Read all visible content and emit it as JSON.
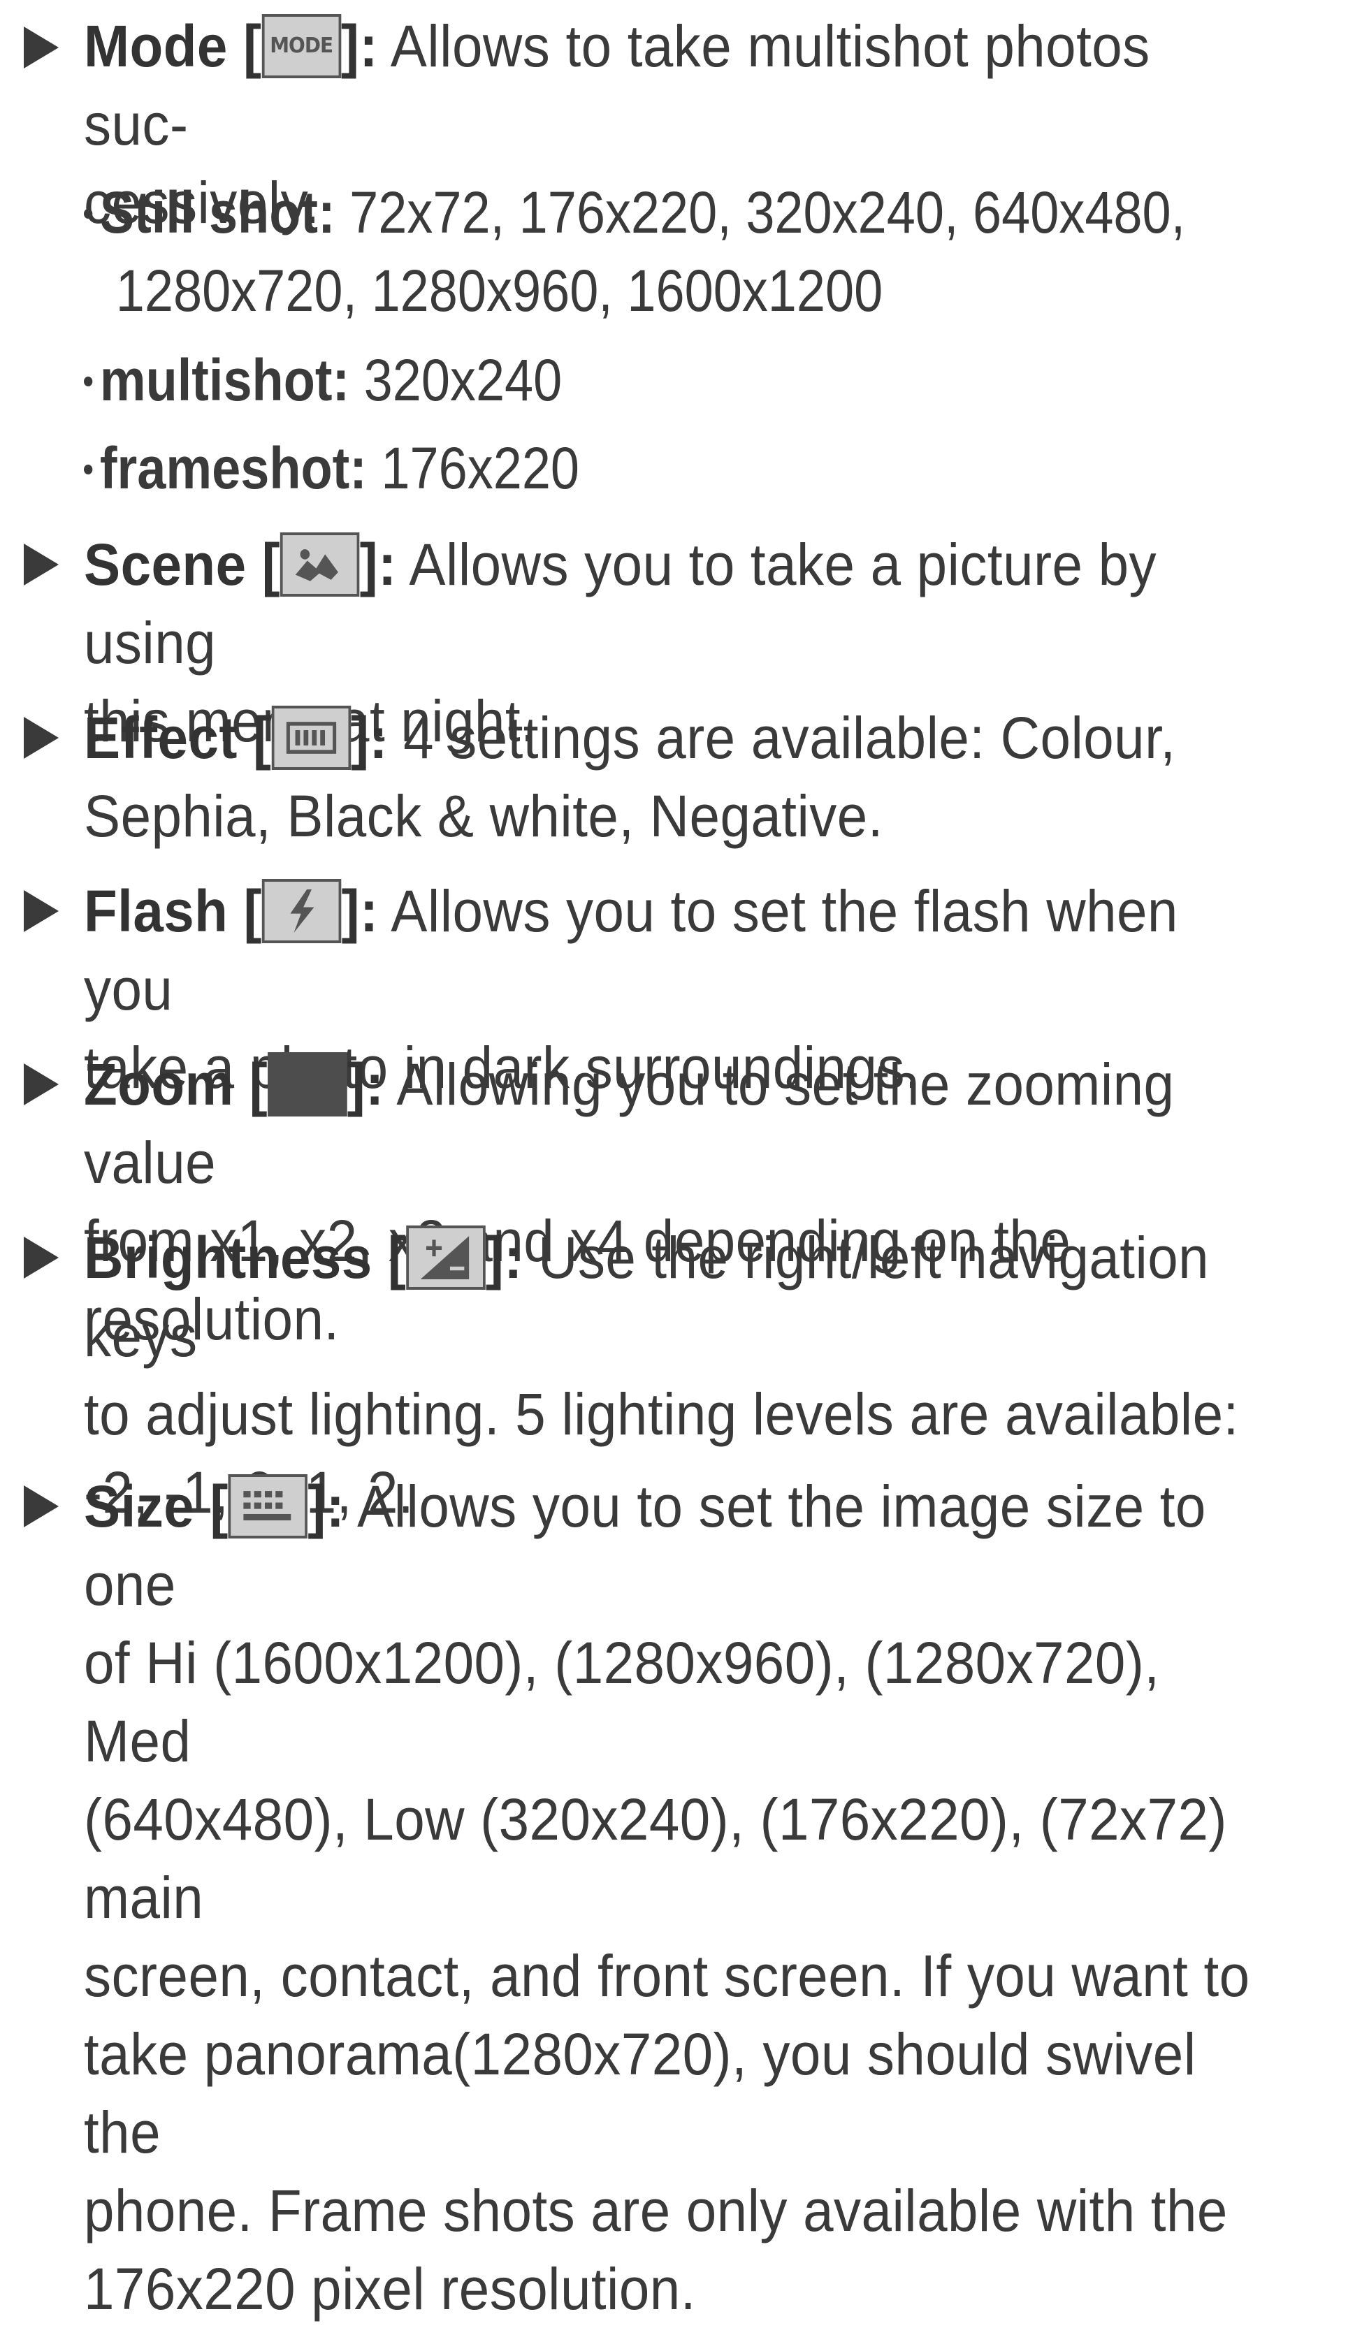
{
  "entries": [
    {
      "title": "Mode",
      "icon": "mode-icon",
      "icon_text": "MODE",
      "desc": "Allows to take multishot photos suc-cessively.",
      "desc_line1": "Allows to take multishot photos suc-",
      "desc_line2": "cessively.",
      "subitems": [
        {
          "label": "Still shot:",
          "value_line1": "72x72, 176x220, 320x240, 640x480,",
          "value_line2": "1280x720, 1280x960, 1600x1200"
        },
        {
          "label": "multishot:",
          "value_line1": "320x240"
        },
        {
          "label": "frameshot:",
          "value_line1": "176x220"
        }
      ]
    },
    {
      "title": "Scene",
      "icon": "scene-night-icon",
      "desc_line1": "Allows you to take a picture by using",
      "desc_line2": "this menu at night."
    },
    {
      "title": "Effect",
      "icon": "effect-icon",
      "desc_line1": "4 settings are available: Colour,",
      "desc_line2": "Sephia, Black & white, Negative."
    },
    {
      "title": "Flash",
      "icon": "flash-icon",
      "desc_line1": "Allows you to set the flash when you",
      "desc_line2": "take a photo in dark surroundings."
    },
    {
      "title": "Zoom",
      "icon": "zoom-icon",
      "desc_line1": "Allowing you to set the zooming value",
      "desc_line2": "from x1, x2, x3 and x4 depending on the resolution."
    },
    {
      "title": "Brightness",
      "icon": "brightness-icon",
      "desc_line1": "Use the right/left navigation keys",
      "desc_line2": "to adjust lighting. 5 lighting levels are available:",
      "desc_line3": "-2, -1, 0, 1, 2."
    },
    {
      "title": "Size",
      "icon": "size-icon",
      "desc_line1": "Allows you to set the image size to one",
      "desc_line2": "of Hi (1600x1200), (1280x960), (1280x720), Med",
      "desc_line3": "(640x480), Low (320x240), (176x220), (72x72) main",
      "desc_line4": "screen, contact, and front screen. If you want to",
      "desc_line5": "take panorama(1280x720), you should swivel the",
      "desc_line6": "phone. Frame shots are only available with the",
      "desc_line7": "176x220 pixel resolution."
    }
  ],
  "punct": {
    "open": " [",
    "close": "]:"
  }
}
